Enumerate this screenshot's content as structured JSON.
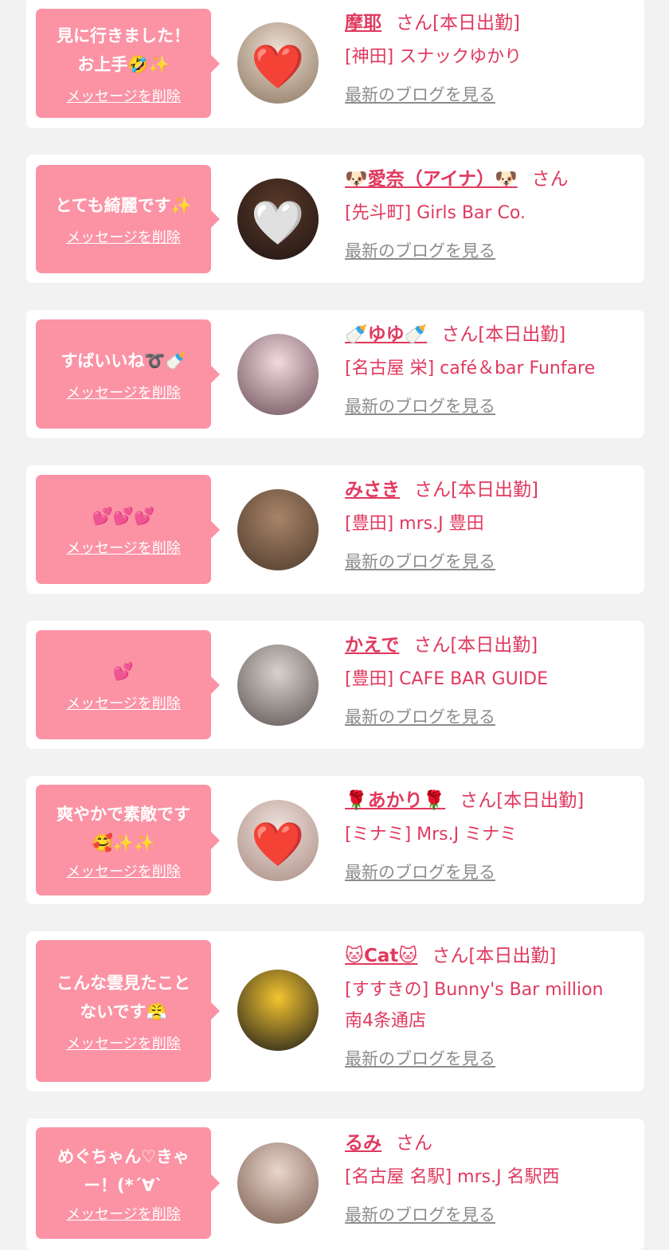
{
  "entries": [
    {
      "message": "見に行きました！\nお上手🤣✨",
      "delete_label": "メッセージを削除",
      "name": "摩耶",
      "suffix": "さん[本日出勤]",
      "shop": "[神田] スナックゆかり",
      "blog_label": "最新のブログを見る",
      "avatar_colors": [
        "#efe0d2",
        "#8a7660"
      ],
      "avatar_heart": "❤️"
    },
    {
      "message": "とても綺麗です✨",
      "delete_label": "メッセージを削除",
      "name": "🐶愛奈（アイナ）🐶",
      "suffix": "さん",
      "shop": "[先斗町] Girls Bar Co.",
      "blog_label": "最新のブログを見る",
      "avatar_colors": [
        "#5b3a2a",
        "#201512"
      ],
      "avatar_heart": "🤍"
    },
    {
      "message": "すばいいね➰🍼",
      "delete_label": "メッセージを削除",
      "name": "🍼ゆゆ🍼",
      "suffix": "さん[本日出勤]",
      "shop": "[名古屋 栄] café＆bar Funfare",
      "blog_label": "最新のブログを見る",
      "avatar_colors": [
        "#f3d9e0",
        "#6c5058"
      ],
      "avatar_heart": ""
    },
    {
      "message": "💕💕💕",
      "delete_label": "メッセージを削除",
      "name": "みさき",
      "suffix": "さん[本日出勤]",
      "shop": "[豊田] mrs.J 豊田",
      "blog_label": "最新のブログを見る",
      "avatar_colors": [
        "#a88468",
        "#4e3a2c"
      ],
      "avatar_heart": ""
    },
    {
      "message": "💕",
      "delete_label": "メッセージを削除",
      "name": "かえで",
      "suffix": "さん[本日出勤]",
      "shop": "[豊田] CAFE BAR GUIDE",
      "blog_label": "最新のブログを見る",
      "avatar_colors": [
        "#d8d2ce",
        "#5d5452"
      ],
      "avatar_heart": ""
    },
    {
      "message": "爽やかで素敵です\n🥰✨✨",
      "delete_label": "メッセージを削除",
      "name": "🌹あかり🌹",
      "suffix": "さん[本日出勤]",
      "shop": "[ミナミ] Mrs.J ミナミ",
      "blog_label": "最新のブログを見る",
      "avatar_colors": [
        "#efe1dc",
        "#a98c83"
      ],
      "avatar_heart": "❤️"
    },
    {
      "message": "こんな雲見たこと\nないです😤",
      "delete_label": "メッセージを削除",
      "name": "🐱Cat🐱",
      "suffix": "さん[本日出勤]",
      "shop": "[すすきの] Bunny's Bar million\n南4条通店",
      "blog_label": "最新のブログを見る",
      "avatar_colors": [
        "#f4c430",
        "#1a1a1a"
      ],
      "avatar_heart": ""
    },
    {
      "message": "めぐちゃん♡きゃ\nー！(*´∀`",
      "delete_label": "メッセージを削除",
      "name": "るみ",
      "suffix": "さん",
      "shop": "[名古屋 名駅] mrs.J 名駅西",
      "blog_label": "最新のブログを見る",
      "avatar_colors": [
        "#ead6cc",
        "#7a5d50"
      ],
      "avatar_heart": ""
    }
  ]
}
